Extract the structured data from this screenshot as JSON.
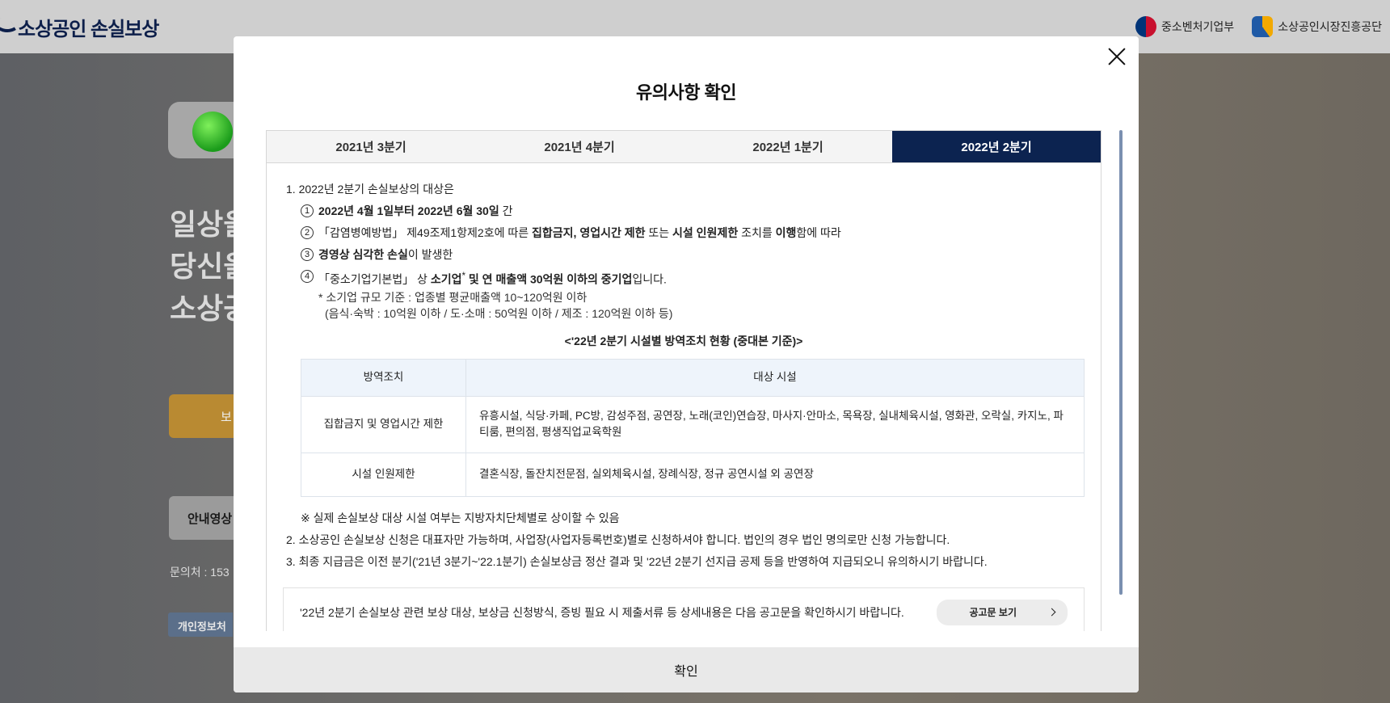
{
  "background": {
    "logo_text": "소상공인 손실보상",
    "orgs": [
      "중소벤처기업부",
      "소상공인시장진흥공단"
    ],
    "headline_lines": [
      "일상을",
      "당신을",
      "소상공"
    ],
    "orange_btn": "보",
    "grey_btn": "안내영상",
    "contact": "문의처 : 153",
    "privacy": "개인정보처"
  },
  "modal": {
    "title": "유의사항 확인",
    "tabs": [
      "2021년 3분기",
      "2021년 4분기",
      "2022년 1분기",
      "2022년 2분기"
    ],
    "active_tab": 3,
    "item1": "1. 2022년 2분기 손실보상의 대상은",
    "sub1_num": "1",
    "sub1_bold": "2022년 4월 1일부터 2022년 6월 30일",
    "sub1_rest": " 간",
    "sub2_num": "2",
    "sub2_a": "「감염병예방법」 제49조제1항제2호에 따른 ",
    "sub2_b": "집합금지, 영업시간 제한",
    "sub2_c": " 또는 ",
    "sub2_d": "시설 인원제한",
    "sub2_e": " 조치를 ",
    "sub2_f": "이행",
    "sub2_g": "함에 따라",
    "sub3_num": "3",
    "sub3_bold": "경영상 심각한 손실",
    "sub3_rest": "이 발생한",
    "sub4_num": "4",
    "sub4_a": "「중소기업기본법」 상 ",
    "sub4_b": "소기업",
    "sub4_star": "*",
    "sub4_c": " 및 연 매출액 30억원 이하의 중기업",
    "sub4_d": "입니다.",
    "note1": "* 소기업 규모 기준 : 업종별 평균매출액 10~120억원 이하",
    "note2": "(음식·숙박 : 10억원 이하 / 도·소매 : 50억원 이하 / 제조 : 120억원 이하 등)",
    "table_caption": "<'22년 2분기 시설별 방역조치 현황 (중대본 기준)>",
    "table_headers": [
      "방역조치",
      "대상 시설"
    ],
    "table_rows": [
      {
        "measure": "집합금지 및 영업시간 제한",
        "facilities": "유흥시설, 식당·카페, PC방, 감성주점, 공연장, 노래(코인)연습장, 마사지·안마소, 목욕장, 실내체육시설, 영화관, 오락실, 카지노, 파티룸, 편의점, 평생직업교육학원"
      },
      {
        "measure": "시설 인원제한",
        "facilities": "결혼식장, 돌잔치전문점, 실외체육시설, 장례식장, 정규 공연시설 외 공연장"
      }
    ],
    "footnote": "※ 실제 손실보상 대상 시설 여부는 지방자치단체별로 상이할 수 있음",
    "item2": "2. 소상공인 손실보상 신청은 대표자만 가능하며, 사업장(사업자등록번호)별로 신청하셔야 합니다. 법인의 경우 법인 명의로만 신청 가능합니다.",
    "item3": "3. 최종 지급금은 이전 분기('21년 3분기~'22.1분기) 손실보상금 정산 결과 및 '22년 2분기 선지급 공제 등을 반영하여 지급되오니 유의하시기 바랍니다.",
    "notice_text": "'22년 2분기 손실보상 관련 보상 대상, 보상금 신청방식, 증빙 필요 시 제출서류 등 상세내용은 다음 공고문을 확인하시기 바랍니다.",
    "notice_btn": "공고문 보기",
    "confirm": "확인"
  }
}
